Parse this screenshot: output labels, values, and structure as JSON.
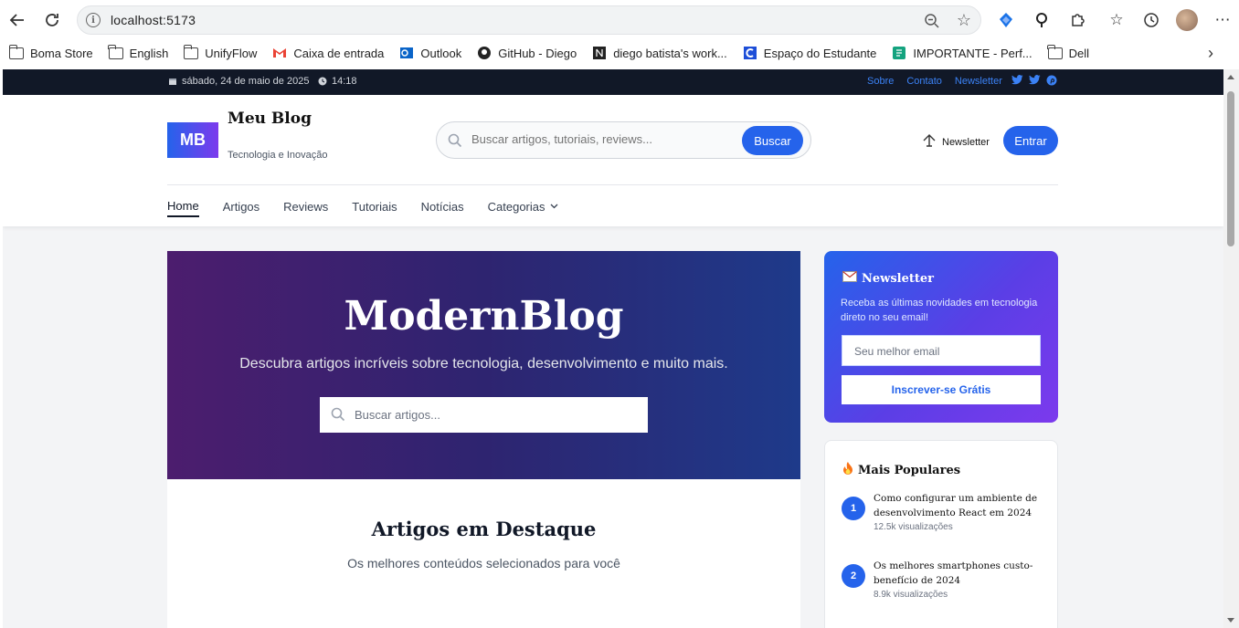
{
  "browser": {
    "url": "localhost:5173",
    "bookmarks": [
      {
        "label": "Boma Store",
        "icon": "folder-icon"
      },
      {
        "label": "English",
        "icon": "folder-icon"
      },
      {
        "label": "UnifyFlow",
        "icon": "folder-icon"
      },
      {
        "label": "Caixa de entrada",
        "icon": "gmail-icon"
      },
      {
        "label": "Outlook",
        "icon": "outlook-icon"
      },
      {
        "label": "GitHub - Diego",
        "icon": "github-icon"
      },
      {
        "label": "diego batista's work...",
        "icon": "notion-icon"
      },
      {
        "label": "Espaço do Estudante",
        "icon": "student-icon"
      },
      {
        "label": "IMPORTANTE - Perf...",
        "icon": "doc-icon"
      },
      {
        "label": "Dell",
        "icon": "folder-icon"
      }
    ]
  },
  "topbar": {
    "date": "sábado, 24 de maio de 2025",
    "time": "14:18",
    "links": [
      "Sobre",
      "Contato",
      "Newsletter"
    ]
  },
  "header": {
    "logo_text": "MB",
    "site_name": "Meu Blog",
    "tagline": "Tecnologia e Inovação",
    "search_placeholder": "Buscar artigos, tutoriais, reviews...",
    "search_button": "Buscar",
    "newsletter_link": "Newsletter",
    "login_button": "Entrar"
  },
  "nav": {
    "items": [
      "Home",
      "Artigos",
      "Reviews",
      "Tutoriais",
      "Notícias",
      "Categorias"
    ]
  },
  "hero": {
    "title": "ModernBlog",
    "subtitle": "Descubra artigos incríveis sobre tecnologia, desenvolvimento e muito mais.",
    "search_placeholder": "Buscar artigos..."
  },
  "featured": {
    "title": "Artigos em Destaque",
    "subtitle": "Os melhores conteúdos selecionados para você"
  },
  "newsletter_card": {
    "title": "Newsletter",
    "description": "Receba as últimas novidades em tecnologia direto no seu email!",
    "email_placeholder": "Seu melhor email",
    "button": "Inscrever-se Grátis"
  },
  "popular": {
    "title": "Mais Populares",
    "items": [
      {
        "rank": "1",
        "title": "Como configurar um ambiente de desenvolvimento React em 2024",
        "views": "12.5k visualizações"
      },
      {
        "rank": "2",
        "title": "Os melhores smartphones custo-benefício de 2024",
        "views": "8.9k visualizações"
      }
    ]
  },
  "colors": {
    "accent": "#2563eb",
    "topbar_bg": "#111827",
    "hero_start": "#4c1d6e",
    "hero_end": "#1e3a8a"
  }
}
